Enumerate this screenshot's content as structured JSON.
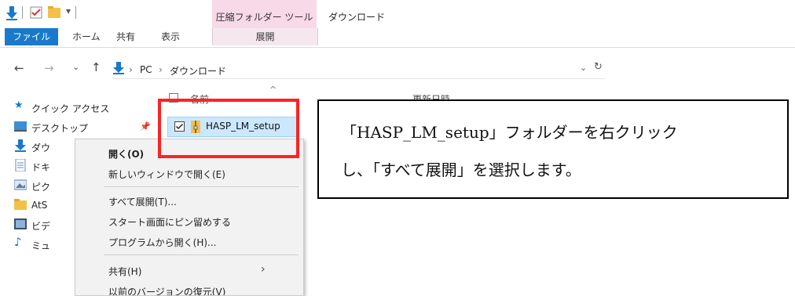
{
  "ribbon": {
    "tools_label": "圧縮フォルダー ツール",
    "window_title": "ダウンロード",
    "tabs": {
      "file": "ファイル",
      "home": "ホーム",
      "share": "共有",
      "view": "表示",
      "extract": "展開"
    }
  },
  "address_bar": {
    "crumb_pc": "PC",
    "crumb_downloads": "ダウンロード",
    "separator": "›"
  },
  "columns": {
    "name": "名前",
    "date_modified": "更新日時"
  },
  "navigation": {
    "quick_access": "クイック アクセス",
    "items": [
      {
        "label": "デスクトップ",
        "icon": "desktop-icon"
      },
      {
        "label": "ダウ",
        "icon": "download-icon"
      },
      {
        "label": "ドキ",
        "icon": "documents-icon"
      },
      {
        "label": "ピク",
        "icon": "pictures-icon"
      },
      {
        "label": "AtS",
        "icon": "folder-icon"
      },
      {
        "label": "ビデ",
        "icon": "videos-icon"
      },
      {
        "label": "ミュ",
        "icon": "music-icon"
      }
    ]
  },
  "file_list": {
    "selected_item": "HASP_LM_setup"
  },
  "context_menu": {
    "items": [
      {
        "label": "開く(O)",
        "bold": true
      },
      {
        "label": "新しいウィンドウで開く(E)"
      },
      {
        "label": "すべて展開(T)..."
      },
      {
        "label": "スタート画面にピン留めする"
      },
      {
        "label": "プログラムから開く(H)..."
      },
      {
        "label": "共有(H)",
        "has_submenu": true
      },
      {
        "label": "以前のバージョンの復元(V)"
      }
    ]
  },
  "callout": {
    "line1": "「HASP_LM_setup」フォルダーを右クリック",
    "line2": "し、「すべて展開」を選択します。"
  },
  "colors": {
    "accent": "#1979ca",
    "tools_tab": "#f8d9e7",
    "highlight": "#ff2222",
    "selection": "#cce8ff"
  }
}
